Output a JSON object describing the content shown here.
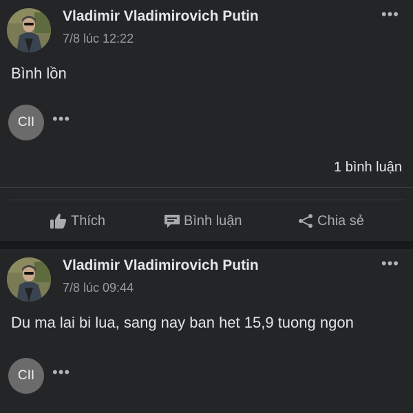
{
  "posts": [
    {
      "author": "Vladimir Vladimirovich Putin",
      "timestamp": "7/8 lúc 12:22",
      "text": "Bình lồn",
      "reactor_initials": "CII",
      "comment_count": "1 bình luận"
    },
    {
      "author": "Vladimir Vladimirovich Putin",
      "timestamp": "7/8 lúc 09:44",
      "text": "Du ma lai bi lua, sang nay ban het 15,9 tuong ngon",
      "reactor_initials": "CII"
    }
  ],
  "actions": {
    "like_label": "Thích",
    "comment_label": "Bình luận",
    "share_label": "Chia sẻ"
  },
  "icons": {
    "more": "more-horizontal-icon",
    "like": "thumbs-up-icon",
    "comment": "comment-bubble-icon",
    "share": "share-icon"
  },
  "colors": {
    "background": "#242526",
    "separator": "#18191a",
    "text": "#e4e6eb",
    "secondary_text": "#9a9b9f",
    "action_text": "#a8aaae",
    "reactor_circle": "#6b6b6b"
  }
}
